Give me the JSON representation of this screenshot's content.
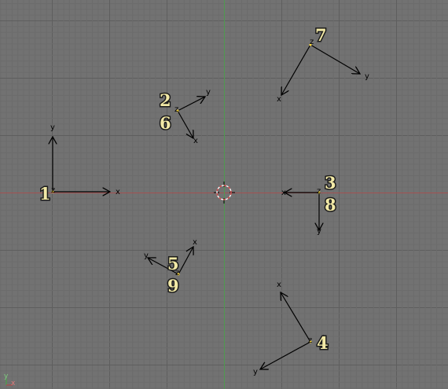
{
  "view": {
    "background": "#727272",
    "grid_minor": "#6c6c6c",
    "grid_major": "#5e5e5e",
    "x_axis_color": "#a35151",
    "y_axis_color": "#4f9a4f",
    "label_color": "#f2e9a6",
    "cursor_color": "#d43a3a"
  },
  "objects": [
    {
      "id": "1",
      "label": "1",
      "x_letter": "x",
      "y_letter": "y",
      "z_letter": "z"
    },
    {
      "id": "2",
      "label": "2",
      "x_letter": "x",
      "y_letter": "y",
      "z_letter": "z"
    },
    {
      "id": "3",
      "label": "3",
      "x_letter": "x",
      "y_letter": "y",
      "z_letter": "z"
    },
    {
      "id": "4",
      "label": "4",
      "x_letter": "x",
      "y_letter": "y",
      "z_letter": "z"
    },
    {
      "id": "5",
      "label": "5",
      "x_letter": "x",
      "y_letter": "y",
      "z_letter": "z"
    },
    {
      "id": "6",
      "label": "6"
    },
    {
      "id": "7",
      "label": "7",
      "x_letter": "x",
      "y_letter": "y",
      "z_letter": "z"
    },
    {
      "id": "8",
      "label": "8"
    },
    {
      "id": "9",
      "label": "9"
    }
  ],
  "corner_axis": {
    "x_letter": "x",
    "y_letter": "y"
  }
}
